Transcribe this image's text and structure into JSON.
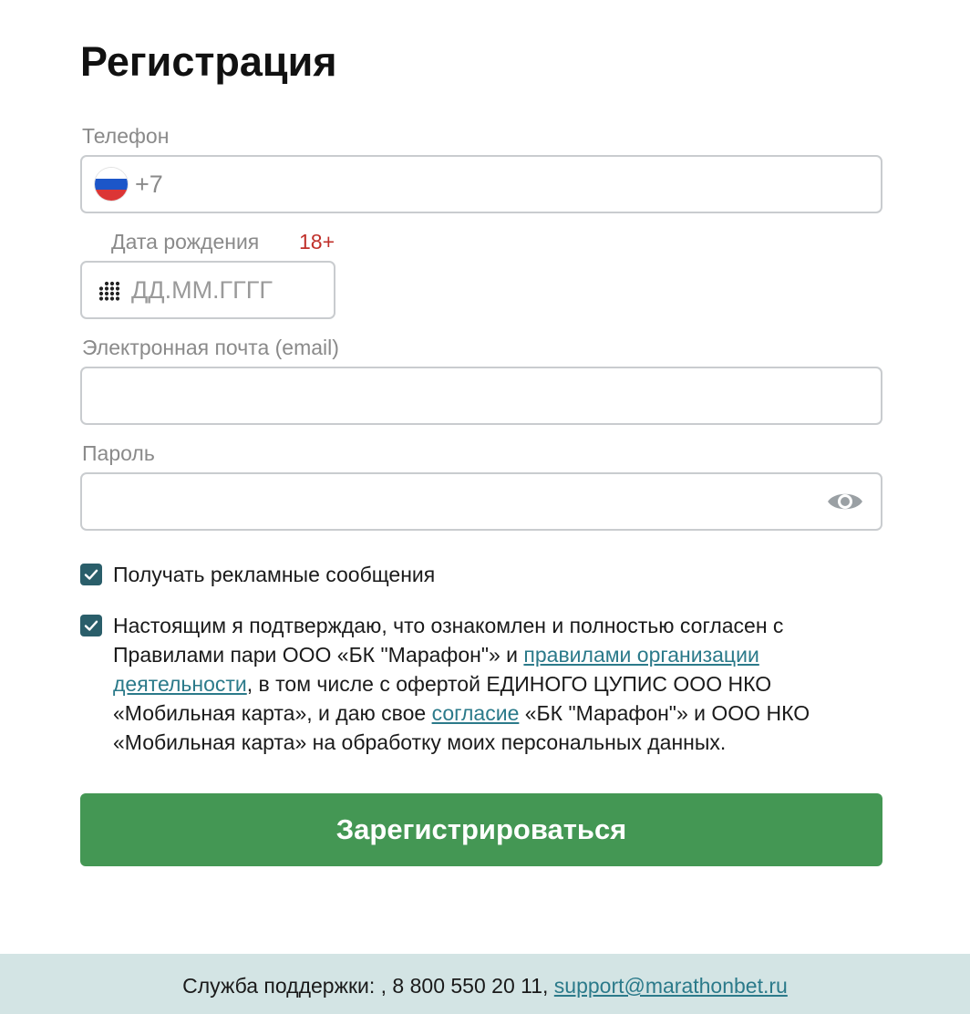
{
  "form": {
    "title": "Регистрация",
    "phone": {
      "label": "Телефон",
      "country_flag": "russia-flag-icon",
      "prefix": "+7",
      "value": ""
    },
    "birth_date": {
      "label": "Дата рождения",
      "age_badge": "18+",
      "placeholder": "ДД.ММ.ГГГГ",
      "icon": "keypad-icon"
    },
    "email": {
      "label": "Электронная почта (email)",
      "value": ""
    },
    "password": {
      "label": "Пароль",
      "value": "",
      "toggle_icon": "eye-icon"
    },
    "promo_checkbox": {
      "checked": true,
      "label": "Получать рекламные сообщения"
    },
    "consent_checkbox": {
      "checked": true,
      "text_1": "Настоящим я подтверждаю, что ознакомлен и полностью согласен с Правилами пари ООО «БК \"Марафон\"» и ",
      "link_rules": "правилами организации деятельности",
      "text_2": ", в том числе с офертой ЕДИНОГО ЦУПИС ООО НКО «Мобильная карта», и даю свое ",
      "link_consent": "согласие",
      "text_3": " «БК \"Марафон\"» и ООО НКО «Мобильная карта» на обработку моих персональных данных."
    },
    "submit_label": "Зарегистрироваться"
  },
  "footer": {
    "support_text": "Служба поддержки: , 8 800 550 20 11, ",
    "support_email": "support@marathonbet.ru"
  },
  "colors": {
    "accent_green": "#449754",
    "checkbox_teal": "#2a5e6a",
    "link_teal": "#2b7a8a",
    "age_red": "#c0302a",
    "footer_bg": "#d3e4e4"
  }
}
